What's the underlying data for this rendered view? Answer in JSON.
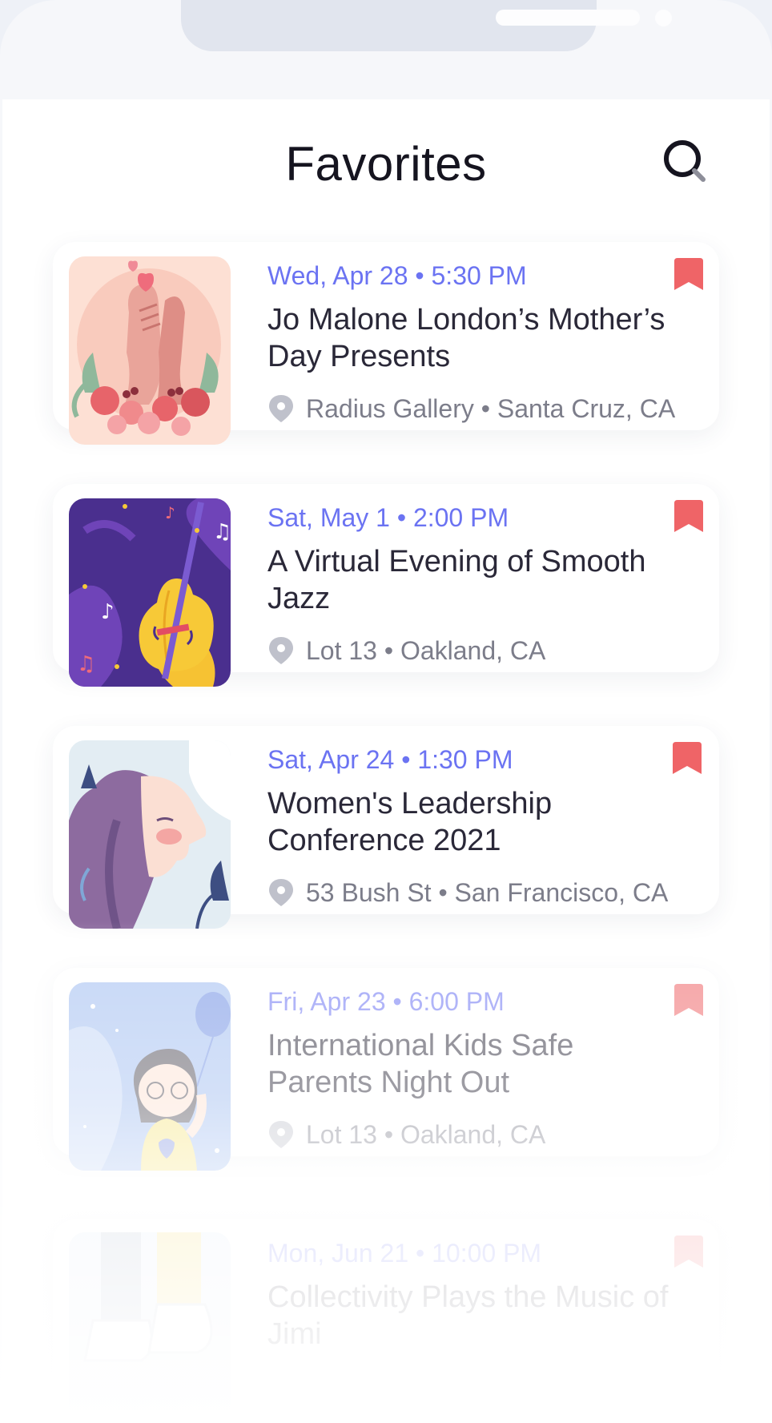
{
  "header": {
    "title": "Favorites",
    "search_icon": "search-icon"
  },
  "events": [
    {
      "date": "Wed, Apr 28 • 5:30 PM",
      "title": "Jo Malone London’s Mother’s Day Presents",
      "location": "Radius Gallery • Santa Cruz, CA",
      "thumbnail": "hands-holding-heart-flowers"
    },
    {
      "date": "Sat, May 1 • 2:00 PM",
      "title": "A Virtual Evening of Smooth Jazz",
      "location": "Lot 13 • Oakland, CA",
      "thumbnail": "cello-music-notes"
    },
    {
      "date": "Sat, Apr 24 • 1:30 PM",
      "title": "Women's Leadership Conference 2021",
      "location": "53 Bush St • San Francisco, CA",
      "thumbnail": "woman-profile-leaves"
    },
    {
      "date": "Fri, Apr 23 • 6:00 PM",
      "title": "International Kids Safe Parents Night Out",
      "location": "Lot 13 • Oakland, CA",
      "thumbnail": "child-with-balloon"
    },
    {
      "date": "Mon, Jun 21 • 10:00 PM",
      "title": "Collectivity Plays the Music of Jimi",
      "location": "",
      "thumbnail": "feet-sneakers"
    }
  ],
  "colors": {
    "accent": "#6b73f2",
    "bookmark": "#ef6467",
    "title": "#2a2838",
    "muted": "#7c7d8a"
  }
}
